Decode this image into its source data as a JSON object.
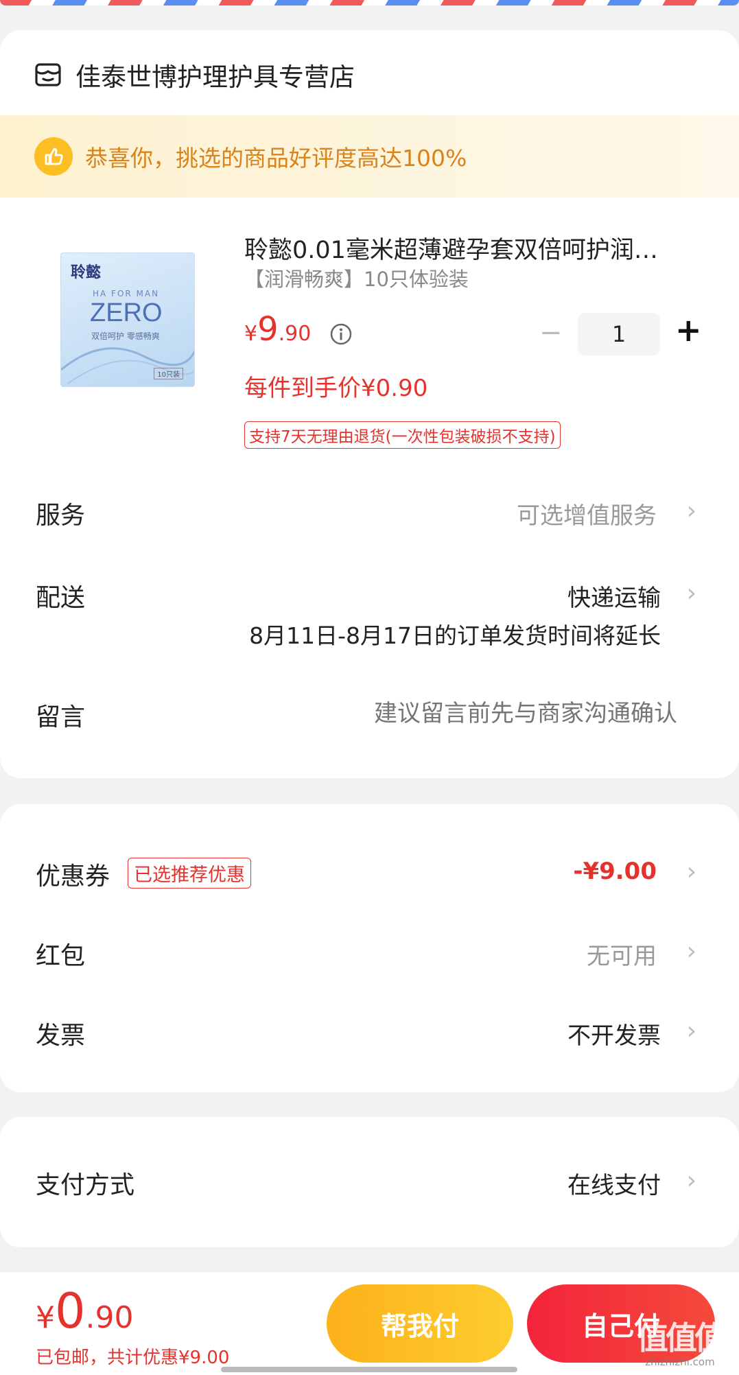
{
  "store": {
    "icon": "store-icon",
    "name": "佳泰世博护理护具专营店"
  },
  "banner": {
    "icon": "thumbs-up-icon",
    "text": "恭喜你，挑选的商品好评度高达100%"
  },
  "product": {
    "title": "聆懿0.01毫米超薄避孕套双倍呵护润…",
    "spec": "【润滑畅爽】10只体验装",
    "image": {
      "brand": "聆懿",
      "line1": "HA FOR MAN",
      "name": "ZERO",
      "tagline": "双倍呵护 零感畅爽",
      "count": "10只装"
    },
    "price_symbol": "¥",
    "price_int": "9",
    "price_dec": ".90",
    "info_icon": "info-icon",
    "quantity": "1",
    "minus": "−",
    "plus": "+",
    "final_price": "每件到手价¥0.90",
    "return_policy": "支持7天无理由退货(一次性包装破损不支持)"
  },
  "service": {
    "label": "服务",
    "value": "可选增值服务"
  },
  "delivery": {
    "label": "配送",
    "value": "快递运输",
    "note": "8月11日-8月17日的订单发货时间将延长"
  },
  "message": {
    "label": "留言",
    "placeholder": "建议留言前先与商家沟通确认"
  },
  "coupon": {
    "label": "优惠券",
    "badge": "已选推荐优惠",
    "value": "-¥9.00"
  },
  "redpacket": {
    "label": "红包",
    "value": "无可用"
  },
  "invoice": {
    "label": "发票",
    "value": "不开发票"
  },
  "payment": {
    "label": "支付方式",
    "value": "在线支付"
  },
  "chevron": "›",
  "bottom": {
    "price_symbol": "¥",
    "price_int": "0",
    "price_dec": ".90",
    "summary_a": "已包邮",
    "summary_b": "，共计优惠¥9.00",
    "help_pay": "帮我付",
    "self_pay": "自己付",
    "watermark": "值值值",
    "watermark_sub": "zhizhizhi.com"
  },
  "colors": {
    "accent_red": "#e5322d",
    "banner_bg": "#fdf6dc",
    "banner_text": "#d9831a",
    "help_btn": "#fdb81d",
    "self_btn": "#f3243b"
  }
}
